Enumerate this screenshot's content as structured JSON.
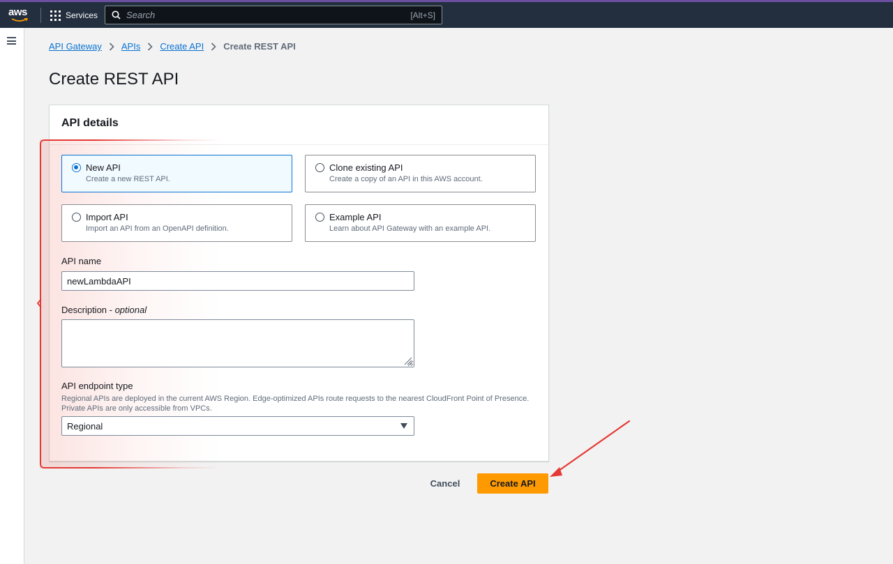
{
  "topbar": {
    "logo_text": "aws",
    "services_label": "Services",
    "search_placeholder": "Search",
    "search_shortcut": "[Alt+S]"
  },
  "breadcrumb": {
    "items": [
      "API Gateway",
      "APIs",
      "Create API"
    ],
    "current": "Create REST API"
  },
  "page": {
    "title": "Create REST API"
  },
  "api_details": {
    "header": "API details",
    "options": [
      {
        "title": "New API",
        "description": "Create a new REST API.",
        "selected": true
      },
      {
        "title": "Clone existing API",
        "description": "Create a copy of an API in this AWS account.",
        "selected": false
      },
      {
        "title": "Import API",
        "description": "Import an API from an OpenAPI definition.",
        "selected": false
      },
      {
        "title": "Example API",
        "description": "Learn about API Gateway with an example API.",
        "selected": false
      }
    ],
    "api_name": {
      "label": "API name",
      "value": "newLambdaAPI"
    },
    "description": {
      "label": "Description - ",
      "label_optional": "optional",
      "value": ""
    },
    "endpoint_type": {
      "label": "API endpoint type",
      "hint": "Regional APIs are deployed in the current AWS Region. Edge-optimized APIs route requests to the nearest CloudFront Point of Presence. Private APIs are only accessible from VPCs.",
      "selected": "Regional"
    }
  },
  "actions": {
    "cancel_label": "Cancel",
    "create_label": "Create API"
  },
  "colors": {
    "nav_bg": "#232f3e",
    "accent_blue": "#0972d3",
    "primary_button": "#ff9900",
    "annotation_red": "#e53935"
  }
}
